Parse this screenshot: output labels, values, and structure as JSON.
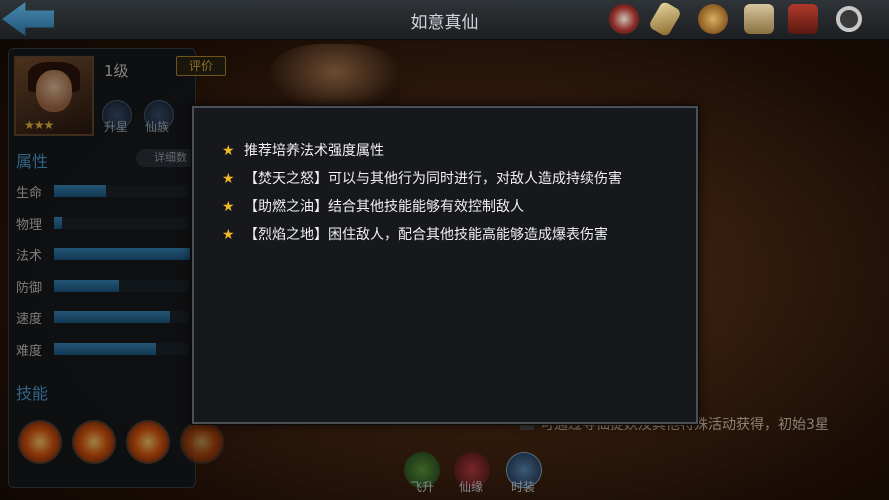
{
  "header": {
    "title": "如意真仙",
    "icons": [
      "seal-icon",
      "scroll-icon",
      "coin-icon",
      "map-icon",
      "book-icon",
      "search-icon"
    ]
  },
  "hero": {
    "level": "1级",
    "stars": "★★★",
    "rate_label": "评价",
    "buttons": [
      "升星",
      "仙族"
    ]
  },
  "attributes": {
    "title": "属性",
    "detail_label": "详细数",
    "stats": [
      {
        "label": "生命",
        "value": 0.38
      },
      {
        "label": "物理",
        "value": 0.06
      },
      {
        "label": "法术",
        "value": 1.0
      },
      {
        "label": "防御",
        "value": 0.48
      },
      {
        "label": "速度",
        "value": 0.85
      },
      {
        "label": "难度",
        "value": 0.75
      }
    ]
  },
  "skills": {
    "title": "技能"
  },
  "scene_hint": "可通过寻仙捉妖及其他特殊活动获得，初始3星",
  "bottom_tabs": [
    "飞升",
    "仙缘",
    "时装"
  ],
  "popup": {
    "tips": [
      "推荐培养法术强度属性",
      "【焚天之怒】可以与其他行为同时进行，对敌人造成持续伤害",
      "【助燃之油】结合其他技能能够有效控制敌人",
      "【烈焰之地】困住敌人，配合其他技能高能够造成爆表伤害"
    ]
  }
}
